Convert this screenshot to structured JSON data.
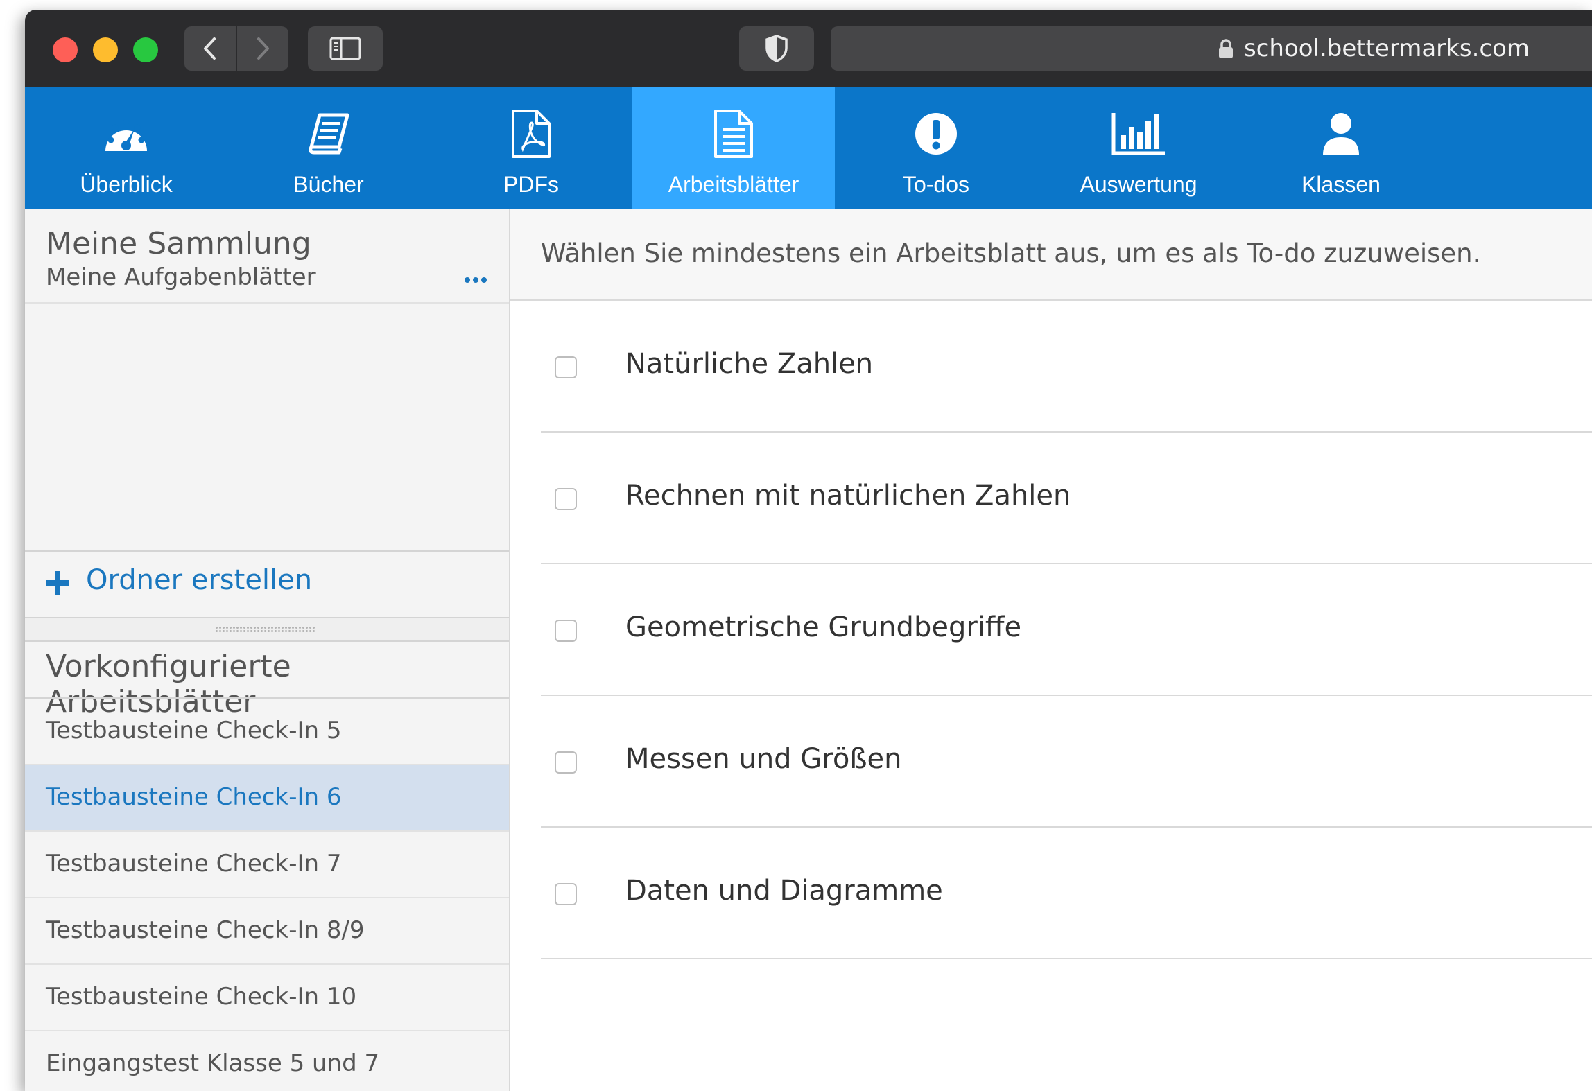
{
  "browser": {
    "url": "school.bettermarks.com"
  },
  "nav": {
    "tabs": [
      {
        "label": "Überblick",
        "icon": "dashboard-icon"
      },
      {
        "label": "Bücher",
        "icon": "book-icon"
      },
      {
        "label": "PDFs",
        "icon": "pdf-icon"
      },
      {
        "label": "Arbeitsblätter",
        "icon": "document-icon"
      },
      {
        "label": "To-dos",
        "icon": "exclamation-icon"
      },
      {
        "label": "Auswertung",
        "icon": "bar-chart-icon"
      },
      {
        "label": "Klassen",
        "icon": "user-icon"
      }
    ],
    "active_tab": "Arbeitsblätter",
    "color": "#0b76c9",
    "active_color": "#33a8ff"
  },
  "sidebar": {
    "collection_title": "Meine Sammlung",
    "collection_items": [
      {
        "label": "Meine Aufgabenblätter"
      }
    ],
    "add_folder_label": "Ordner erstellen",
    "preconfigured_title": "Vorkonfigurierte Arbeitsblätter",
    "preconfigured_items": [
      {
        "label": "Testbausteine Check-In 5"
      },
      {
        "label": "Testbausteine Check-In 6"
      },
      {
        "label": "Testbausteine Check-In 7"
      },
      {
        "label": "Testbausteine Check-In 8/9"
      },
      {
        "label": "Testbausteine Check-In 10"
      },
      {
        "label": "Eingangstest Klasse 5 und 7"
      }
    ],
    "selected_item": "Testbausteine Check-In 6"
  },
  "main": {
    "instruction": "Wählen Sie mindestens ein Arbeitsblatt aus, um es als To-do zuzuweisen.",
    "worksheets": [
      {
        "label": "Natürliche Zahlen",
        "checked": false
      },
      {
        "label": "Rechnen mit natürlichen Zahlen",
        "checked": false
      },
      {
        "label": "Geometrische Grundbegriffe",
        "checked": false
      },
      {
        "label": "Messen und Größen",
        "checked": false
      },
      {
        "label": "Daten und Diagramme",
        "checked": false
      }
    ]
  }
}
